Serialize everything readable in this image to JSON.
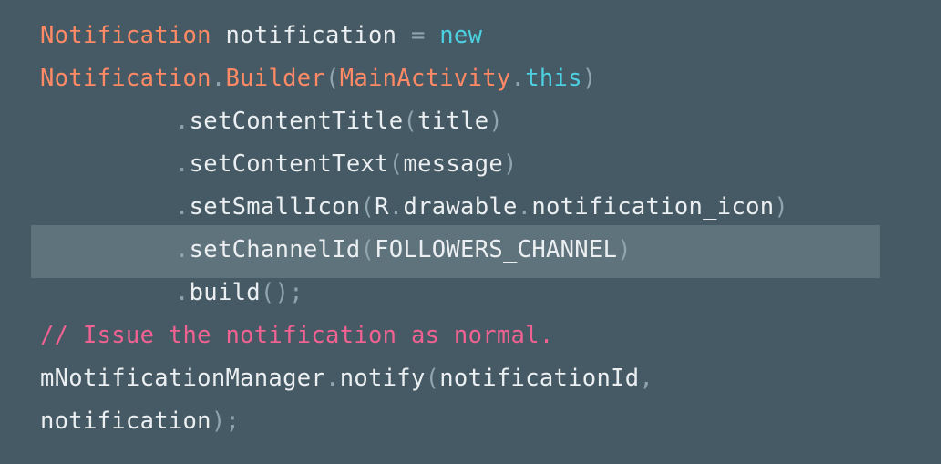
{
  "code": {
    "lines": [
      {
        "tokens": [
          {
            "text": "Notification",
            "kind": "type"
          },
          {
            "text": " notification ",
            "kind": "id"
          },
          {
            "text": "=",
            "kind": "punc"
          },
          {
            "text": " ",
            "kind": "id"
          },
          {
            "text": "new",
            "kind": "kw"
          }
        ]
      },
      {
        "tokens": [
          {
            "text": "Notification",
            "kind": "type"
          },
          {
            "text": ".",
            "kind": "punc"
          },
          {
            "text": "Builder",
            "kind": "type"
          },
          {
            "text": "(",
            "kind": "punc"
          },
          {
            "text": "MainActivity",
            "kind": "type"
          },
          {
            "text": ".",
            "kind": "punc"
          },
          {
            "text": "this",
            "kind": "kw"
          },
          {
            "text": ")",
            "kind": "punc"
          }
        ]
      },
      {
        "indent": true,
        "tokens": [
          {
            "text": ".",
            "kind": "punc"
          },
          {
            "text": "setContentTitle",
            "kind": "id"
          },
          {
            "text": "(",
            "kind": "punc"
          },
          {
            "text": "title",
            "kind": "id"
          },
          {
            "text": ")",
            "kind": "punc"
          }
        ]
      },
      {
        "indent": true,
        "tokens": [
          {
            "text": ".",
            "kind": "punc"
          },
          {
            "text": "setContentText",
            "kind": "id"
          },
          {
            "text": "(",
            "kind": "punc"
          },
          {
            "text": "message",
            "kind": "id"
          },
          {
            "text": ")",
            "kind": "punc"
          }
        ]
      },
      {
        "indent": true,
        "tokens": [
          {
            "text": ".",
            "kind": "punc"
          },
          {
            "text": "setSmallIcon",
            "kind": "id"
          },
          {
            "text": "(",
            "kind": "punc"
          },
          {
            "text": "R",
            "kind": "id"
          },
          {
            "text": ".",
            "kind": "punc"
          },
          {
            "text": "drawable",
            "kind": "id"
          },
          {
            "text": ".",
            "kind": "punc"
          },
          {
            "text": "notification_icon",
            "kind": "id"
          },
          {
            "text": ")",
            "kind": "punc"
          }
        ]
      },
      {
        "indent": true,
        "highlighted": true,
        "tokens": [
          {
            "text": ".",
            "kind": "punc"
          },
          {
            "text": "setChannelId",
            "kind": "id"
          },
          {
            "text": "(",
            "kind": "punc"
          },
          {
            "text": "FOLLOWERS_CHANNEL",
            "kind": "id"
          },
          {
            "text": ")",
            "kind": "punc"
          }
        ]
      },
      {
        "indent": true,
        "tokens": [
          {
            "text": ".",
            "kind": "punc"
          },
          {
            "text": "build",
            "kind": "id"
          },
          {
            "text": "();",
            "kind": "punc"
          }
        ]
      },
      {
        "tokens": [
          {
            "text": "// Issue the notification as normal.",
            "kind": "comment"
          }
        ]
      },
      {
        "tokens": [
          {
            "text": "mNotificationManager",
            "kind": "id"
          },
          {
            "text": ".",
            "kind": "punc"
          },
          {
            "text": "notify",
            "kind": "id"
          },
          {
            "text": "(",
            "kind": "punc"
          },
          {
            "text": "notificationId",
            "kind": "id"
          },
          {
            "text": ",",
            "kind": "punc"
          }
        ]
      },
      {
        "tokens": [
          {
            "text": "notification",
            "kind": "id"
          },
          {
            "text": ");",
            "kind": "punc"
          }
        ]
      }
    ]
  },
  "colors": {
    "background": "#455a64",
    "highlight": "#5f737d",
    "type": "#ff8a65",
    "keyword": "#4dd0e1",
    "identifier": "#eceff1",
    "punctuation": "#90a4ae",
    "comment": "#f06292"
  }
}
